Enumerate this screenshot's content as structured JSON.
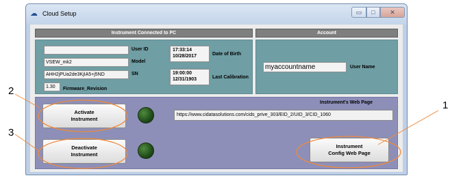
{
  "window": {
    "title": "Cloud Setup",
    "controls": {
      "minimize": "▭",
      "maximize": "□",
      "close": "✕"
    }
  },
  "instrument_panel": {
    "header": "Instrument Connected to PC",
    "user_id": {
      "value": "",
      "label": "User ID"
    },
    "model": {
      "value": "VSEW_mk2",
      "label": "Model"
    },
    "sn": {
      "value": "AHH2jPUa2de3KjIA5+j5ND",
      "label": "SN"
    },
    "firmware": {
      "value": "1.30",
      "label": "Firmware_Revision"
    },
    "date_of_birth": {
      "time": "17:33:14",
      "date": "10/28/2017",
      "label": "Date of Birth"
    },
    "last_calibration": {
      "time": "19:00:00",
      "date": "12/31/1903",
      "label": "Last Calibration"
    }
  },
  "account_panel": {
    "header": "Account",
    "user_name": {
      "value": "myaccountname",
      "label": "User Name"
    }
  },
  "web_panel": {
    "title": "Instrument's Web Page",
    "url": "https://www.cidatasolutions.com/cids_prive_303/EID_2/UID_3/CID_1060"
  },
  "buttons": {
    "activate": "Activate\nInstrument",
    "deactivate": "Deactivate\nInstrument",
    "config": "Instrument\nConfig Web Page"
  },
  "callouts": [
    "1",
    "2",
    "3"
  ],
  "colors": {
    "annotation": "#f08a3c",
    "teal_panel": "#6f9ea4",
    "purple_panel": "#8d8fb8",
    "led": "#1f4d18"
  }
}
